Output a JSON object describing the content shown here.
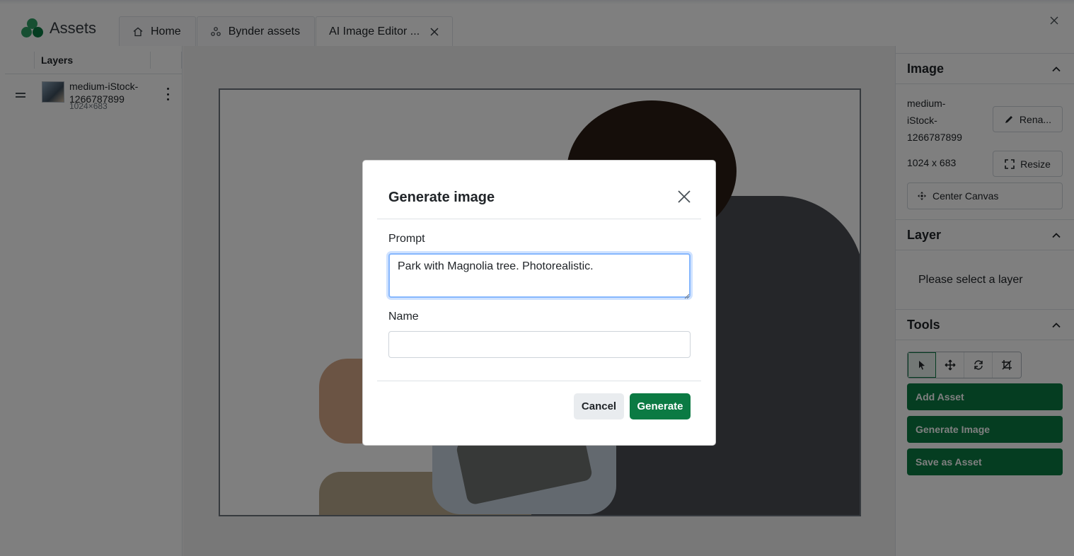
{
  "app": {
    "title": "Assets"
  },
  "tabs": [
    {
      "label": "Home",
      "icon": "home-icon"
    },
    {
      "label": "Bynder assets",
      "icon": "bynder-icon"
    },
    {
      "label": "AI Image Editor ...",
      "icon": "close-icon"
    }
  ],
  "layers": {
    "title": "Layers",
    "items": [
      {
        "name": "medium-iStock-1266787899",
        "dims": "1024×683"
      }
    ]
  },
  "image_panel": {
    "title": "Image",
    "name": "medium-iStock-1266787899",
    "dims": "1024 x 683",
    "rename_label": "Rena...",
    "resize_label": "Resize",
    "center_label": "Center Canvas"
  },
  "layer_panel": {
    "title": "Layer",
    "empty_text": "Please select a layer"
  },
  "tools_panel": {
    "title": "Tools",
    "tools": [
      "select-tool-icon",
      "move-tool-icon",
      "rotate-tool-icon",
      "crop-tool-icon"
    ],
    "add_asset": "Add Asset",
    "generate_image": "Generate Image",
    "save_asset": "Save as Asset"
  },
  "modal": {
    "title": "Generate image",
    "prompt_label": "Prompt",
    "prompt_value": "Park with Magnolia tree. Photorealistic.",
    "name_label": "Name",
    "name_value": "",
    "cancel_label": "Cancel",
    "generate_label": "Generate"
  },
  "colors": {
    "brand_green": "#0b7a43",
    "focus_blue": "#86b7fe"
  }
}
